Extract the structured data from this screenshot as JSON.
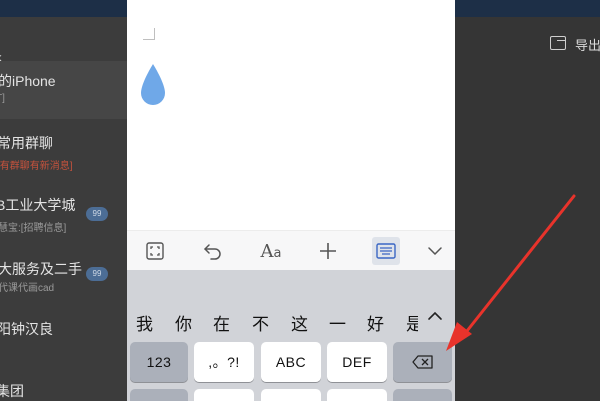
{
  "background_app": {
    "chats": [
      {
        "title": "的iPhone",
        "sub": "T]",
        "alert": false,
        "badge": ""
      },
      {
        "title": "常用群聊",
        "sub": "[有群聊有新消息]",
        "alert": true,
        "badge": ""
      },
      {
        "title": "B工业大学城",
        "sub": "慧宝:[招聘信息]",
        "alert": false,
        "badge": "99"
      },
      {
        "title": "大服务及二手",
        "sub": "代课代画cad",
        "alert": false,
        "badge": "99"
      },
      {
        "title": "阳钟汉良",
        "sub": "",
        "alert": false,
        "badge": ""
      },
      {
        "title": "集团",
        "sub": "",
        "alert": false,
        "badge": ""
      }
    ],
    "export_label": "导出"
  },
  "phone": {
    "toolbar": {
      "font_label": "A",
      "font_label_small": "a"
    },
    "keyboard": {
      "suggestions": [
        "我",
        "你",
        "在",
        "不",
        "这",
        "一",
        "好",
        "是"
      ],
      "keys": {
        "numbers": "123",
        "punctuation": ",。?!",
        "abc": "ABC",
        "def": "DEF"
      }
    }
  },
  "colors": {
    "drop_icon": "#6fa8e8",
    "annotation_arrow": "#e8332b",
    "topbar": "#1d2f47"
  }
}
